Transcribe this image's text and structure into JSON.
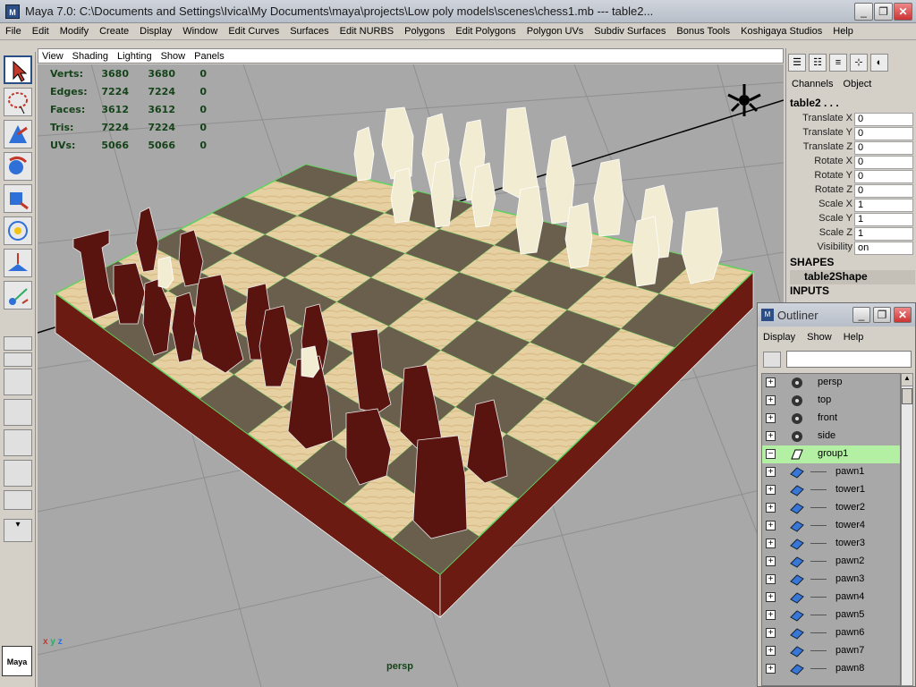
{
  "window": {
    "title": "Maya 7.0: C:\\Documents and Settings\\Ivica\\My Documents\\maya\\projects\\Low poly models\\scenes\\chess1.mb  ---   table2...",
    "minimize": "_",
    "maximize": "❐",
    "close": "✕"
  },
  "menubar": [
    "File",
    "Edit",
    "Modify",
    "Create",
    "Display",
    "Window",
    "Edit Curves",
    "Surfaces",
    "Edit NURBS",
    "Polygons",
    "Edit Polygons",
    "Polygon UVs",
    "Subdiv Surfaces",
    "Bonus Tools",
    "Koshigaya Studios",
    "Help"
  ],
  "panel_menu": [
    "View",
    "Shading",
    "Lighting",
    "Show",
    "Panels"
  ],
  "hud": [
    {
      "label": "Verts:",
      "v1": "3680",
      "v2": "3680",
      "v3": "0"
    },
    {
      "label": "Edges:",
      "v1": "7224",
      "v2": "7224",
      "v3": "0"
    },
    {
      "label": "Faces:",
      "v1": "3612",
      "v2": "3612",
      "v3": "0"
    },
    {
      "label": "Tris:",
      "v1": "7224",
      "v2": "7224",
      "v3": "0"
    },
    {
      "label": "UVs:",
      "v1": "5066",
      "v2": "5066",
      "v3": "0"
    }
  ],
  "viewport_label": "persp",
  "axes_label": "x y z",
  "logo": "Maya",
  "channel_box": {
    "menu": [
      "Channels",
      "Object"
    ],
    "object": "table2 . . .",
    "attributes": [
      {
        "k": "Translate X",
        "v": "0"
      },
      {
        "k": "Translate Y",
        "v": "0"
      },
      {
        "k": "Translate Z",
        "v": "0"
      },
      {
        "k": "Rotate X",
        "v": "0"
      },
      {
        "k": "Rotate Y",
        "v": "0"
      },
      {
        "k": "Rotate Z",
        "v": "0"
      },
      {
        "k": "Scale X",
        "v": "1"
      },
      {
        "k": "Scale Y",
        "v": "1"
      },
      {
        "k": "Scale Z",
        "v": "1"
      },
      {
        "k": "Visibility",
        "v": "on"
      }
    ],
    "shapes_header": "SHAPES",
    "shape": "table2Shape",
    "inputs_header": "INPUTS"
  },
  "outliner": {
    "title": "Outliner",
    "menu": [
      "Display",
      "Show",
      "Help"
    ],
    "items": [
      {
        "name": "persp",
        "type": "camera",
        "expander": "+"
      },
      {
        "name": "top",
        "type": "camera",
        "expander": "+"
      },
      {
        "name": "front",
        "type": "camera",
        "expander": "+"
      },
      {
        "name": "side",
        "type": "camera",
        "expander": "+"
      },
      {
        "name": "group1",
        "type": "group",
        "expander": "−"
      },
      {
        "name": "pawn1",
        "type": "mesh",
        "expander": "+"
      },
      {
        "name": "tower1",
        "type": "mesh",
        "expander": "+"
      },
      {
        "name": "tower2",
        "type": "mesh",
        "expander": "+"
      },
      {
        "name": "tower4",
        "type": "mesh",
        "expander": "+"
      },
      {
        "name": "tower3",
        "type": "mesh",
        "expander": "+"
      },
      {
        "name": "pawn2",
        "type": "mesh",
        "expander": "+"
      },
      {
        "name": "pawn3",
        "type": "mesh",
        "expander": "+"
      },
      {
        "name": "pawn4",
        "type": "mesh",
        "expander": "+"
      },
      {
        "name": "pawn5",
        "type": "mesh",
        "expander": "+"
      },
      {
        "name": "pawn6",
        "type": "mesh",
        "expander": "+"
      },
      {
        "name": "pawn7",
        "type": "mesh",
        "expander": "+"
      },
      {
        "name": "pawn8",
        "type": "mesh",
        "expander": "+"
      }
    ]
  },
  "colors": {
    "dark_piece": "#5a1410",
    "light_piece": "#f2ecd2",
    "light_square": "#e6cfa0",
    "dark_square": "#6a5e4c",
    "board_edge": "#6b1b12",
    "viewport_bg": "#a8a8a8"
  }
}
